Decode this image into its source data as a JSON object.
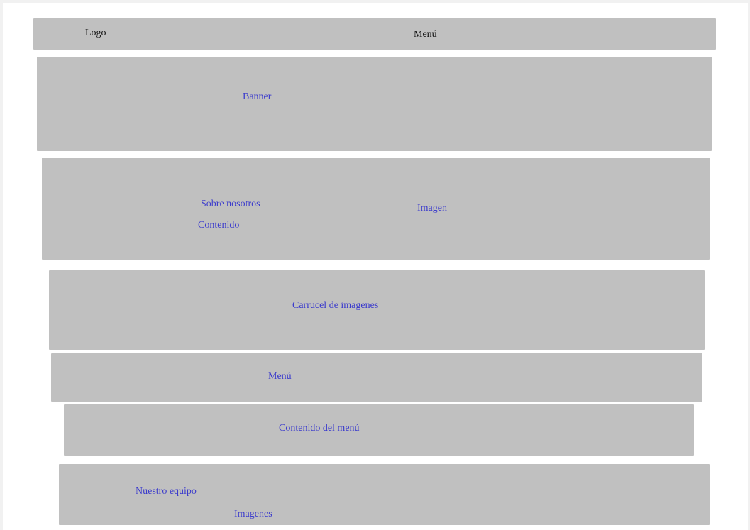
{
  "header": {
    "logo": "Logo",
    "menu": "Menú"
  },
  "banner": {
    "label": "Banner"
  },
  "about": {
    "title": "Sobre nosotros",
    "content": "Contenido",
    "image": "Imagen"
  },
  "carousel": {
    "label": "Carrucel de imagenes"
  },
  "menu_section": {
    "label": "Menú"
  },
  "menu_content": {
    "label": "Contenido del menú"
  },
  "team": {
    "title": "Nuestro equipo",
    "images": "Imagenes"
  },
  "colors": {
    "block": "#c0c0c0",
    "label_text": "#3c3ccc",
    "header_text": "#111111"
  }
}
